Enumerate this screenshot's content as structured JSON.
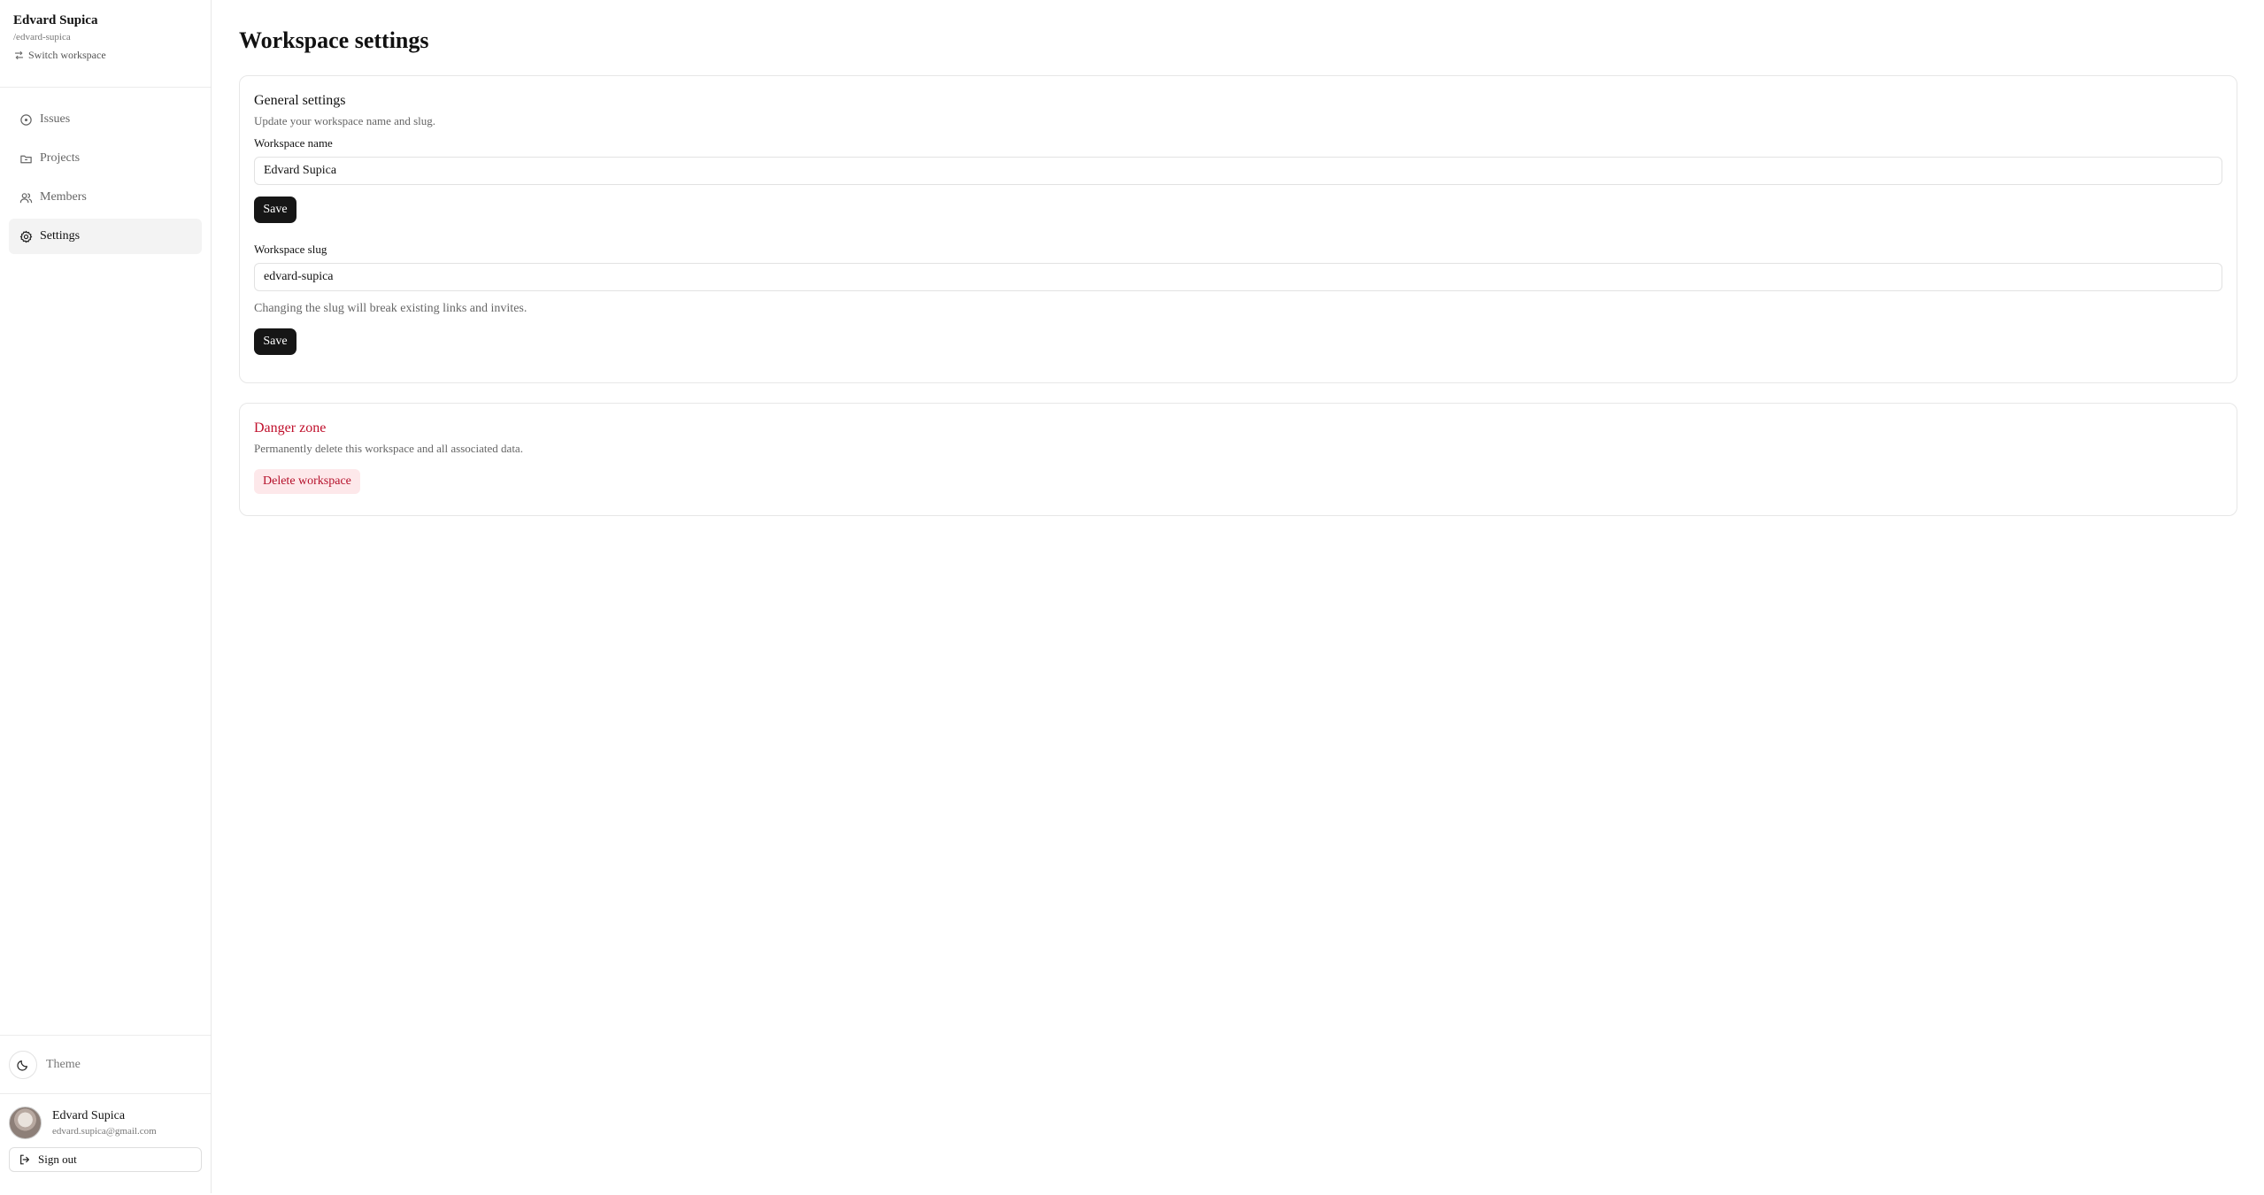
{
  "workspace": {
    "name": "Edvard Supica",
    "slug": "/edvard-supica",
    "switch_label": "Switch workspace"
  },
  "nav": {
    "items": [
      {
        "label": "Issues",
        "icon": "circle-dot-icon"
      },
      {
        "label": "Projects",
        "icon": "folder-icon"
      },
      {
        "label": "Members",
        "icon": "users-icon"
      },
      {
        "label": "Settings",
        "icon": "gear-icon"
      }
    ],
    "active": "Settings"
  },
  "theme": {
    "label": "Theme",
    "icon": "moon-icon"
  },
  "user": {
    "name": "Edvard Supica",
    "email": "edvard.supica@gmail.com",
    "sign_out_label": "Sign out"
  },
  "page": {
    "title": "Workspace settings"
  },
  "general": {
    "title": "General settings",
    "description": "Update your workspace name and slug.",
    "name_label": "Workspace name",
    "name_value": "Edvard Supica",
    "name_save_label": "Save",
    "slug_label": "Workspace slug",
    "slug_value": "edvard-supica",
    "slug_hint": "Changing the slug will break existing links and invites.",
    "slug_save_label": "Save"
  },
  "danger": {
    "title": "Danger zone",
    "description": "Permanently delete this workspace and all associated data.",
    "delete_label": "Delete workspace"
  },
  "colors": {
    "danger": "#c0102c",
    "danger_bg": "#fde8ea",
    "primary_button": "#161616",
    "active_nav_bg": "#f3f3f3"
  }
}
